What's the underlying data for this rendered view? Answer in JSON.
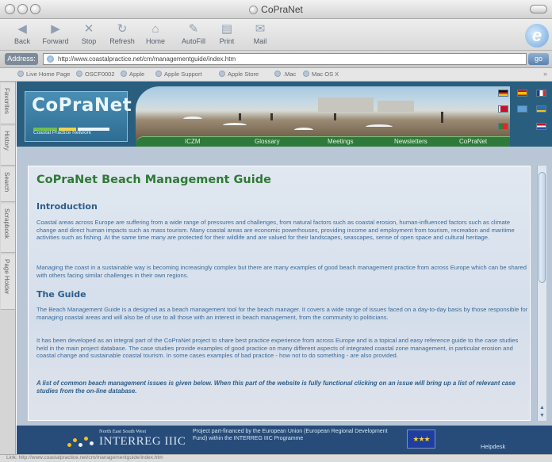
{
  "window": {
    "title": "CoPraNet"
  },
  "toolbar": {
    "buttons": [
      {
        "label": "Back",
        "icon": "back-arrow-icon"
      },
      {
        "label": "Forward",
        "icon": "forward-arrow-icon"
      },
      {
        "label": "Stop",
        "icon": "stop-icon"
      },
      {
        "label": "Refresh",
        "icon": "refresh-icon"
      },
      {
        "label": "Home",
        "icon": "home-icon"
      },
      {
        "label": "AutoFill",
        "icon": "autofill-icon"
      },
      {
        "label": "Print",
        "icon": "print-icon"
      },
      {
        "label": "Mail",
        "icon": "mail-icon"
      }
    ]
  },
  "address": {
    "label": "Address:",
    "url": "http://www.coastalpractice.net/cm/managementguide/index.htm",
    "go_label": "go"
  },
  "favorites": [
    "Live Home Page",
    "OSCF0002",
    "Apple",
    "Apple Support",
    "Apple Store",
    ".Mac",
    "Mac OS X"
  ],
  "sidebar_tabs": [
    "Favorites",
    "History",
    "Search",
    "Scrapbook",
    "Page Holder"
  ],
  "site": {
    "logo_text": "CoPraNet",
    "logo_tagline": "Coastal Practice Network",
    "nav": [
      "ICZM",
      "Glossary",
      "Meetings",
      "Newsletters",
      "CoPraNet"
    ]
  },
  "content": {
    "title": "CoPraNet Beach Management Guide",
    "intro_heading": "Introduction",
    "intro_p1": "Coastal areas across Europe are suffering from a wide range of pressures and challenges, from natural factors such as coastal erosion, human-influenced factors such as climate change and direct human impacts such as mass tourism. Many coastal areas are economic powerhouses, providing income and employment from tourism, recreation and maritime activities such as fishing. At the same time many are protected for their wildlife and are valued for their landscapes, seascapes, sense of open space and cultural heritage.",
    "intro_p2": "Managing the coast in a sustainable way is becoming increasingly complex but there are many examples of good beach management practice from across Europe which can be shared with others facing similar challenges in their own regions.",
    "guide_heading": "The Guide",
    "guide_p1": "The Beach Management Guide is a designed as a beach management tool for the beach manager. It covers a wide range of issues faced on a day-to-day basis by those responsible for managing coastal areas and will also be of use to all those with an interest in beach management, from the community to politicians.",
    "guide_p2": "It has been developed as an integral part of the CoPraNet project to share best practice experience from across Europe and is a topical and easy reference guide to the case studies held in the main project database. The case studies provide examples of good practice on many different aspects of integrated coastal zone management, in particular erosion and coastal change and sustainable coastal tourism. In some cases examples of bad practice - how not to do something - are also provided.",
    "guide_note": "A list of common beach management issues is given below. When this part of the website is fully functional clicking on an issue will bring up a list of relevant case studies from the on-line database."
  },
  "footer": {
    "region": "North East South West",
    "programme": "INTERREG IIIC",
    "funding_text": "Project part-financed by the European Union (European Regional Development Fund) within the INTERREG IIIC Programme",
    "helpdesk": "Helpdesk"
  },
  "status": {
    "text": "Link: http://www.coastalpractice.net/cm/managementguide/index.htm"
  },
  "colors": {
    "heading_green": "#2e7a34",
    "body_blue": "#3c6b9a",
    "banner": "#2a5e7f",
    "footer": "#274c7a"
  }
}
